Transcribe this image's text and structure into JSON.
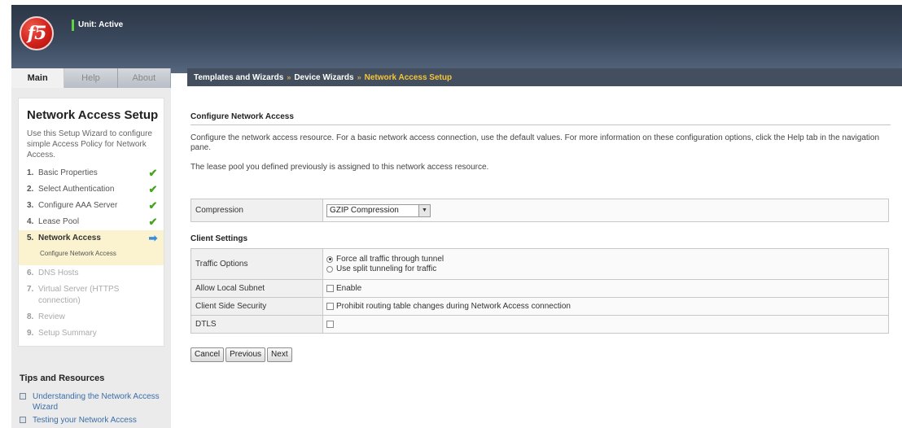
{
  "header": {
    "unit_status": "Unit: Active",
    "logo_text": "f5"
  },
  "tabs": [
    {
      "label": "Main",
      "active": true
    },
    {
      "label": "Help",
      "active": false
    },
    {
      "label": "About",
      "active": false
    }
  ],
  "breadcrumb": {
    "items": [
      "Templates and Wizards",
      "Device Wizards",
      "Network Access Setup"
    ],
    "separator": "»"
  },
  "sidebar": {
    "title": "Network Access Setup",
    "intro": "Use this Setup Wizard to configure simple Access Policy for Network Access.",
    "steps": [
      {
        "num": "1.",
        "label": "Basic Properties",
        "status": "✔"
      },
      {
        "num": "2.",
        "label": "Select Authentication",
        "status": "✔"
      },
      {
        "num": "3.",
        "label": "Configure AAA Server",
        "status": "✔"
      },
      {
        "num": "4.",
        "label": "Lease Pool",
        "status": "✔"
      },
      {
        "num": "5.",
        "label": "Network Access",
        "status": "➡"
      },
      {
        "num": "6.",
        "label": "DNS Hosts",
        "status": ""
      },
      {
        "num": "7.",
        "label": "Virtual Server (HTTPS connection)",
        "status": ""
      },
      {
        "num": "8.",
        "label": "Review",
        "status": ""
      },
      {
        "num": "9.",
        "label": "Setup Summary",
        "status": ""
      }
    ],
    "substep": "Configure Network Access",
    "tips_title": "Tips and Resources",
    "tips": [
      "Understanding the Network Access Wizard",
      "Testing your Network Access"
    ]
  },
  "main": {
    "section_title": "Configure Network Access",
    "description": "Configure the network access resource. For a basic network access connection, use the default values. For more information on these configuration options, click the Help tab in the navigation pane.",
    "lease_note": "The lease pool you defined previously is assigned to this network access resource.",
    "compression": {
      "label": "Compression",
      "value": "GZIP Compression"
    },
    "client_settings_title": "Client Settings",
    "traffic_options": {
      "label": "Traffic Options",
      "options": [
        "Force all traffic through tunnel",
        "Use split tunneling for traffic"
      ],
      "selected": "Force all traffic through tunnel"
    },
    "allow_local_subnet": {
      "label": "Allow Local Subnet",
      "option": "Enable",
      "checked": false
    },
    "client_side_security": {
      "label": "Client Side Security",
      "option": "Prohibit routing table changes during Network Access connection",
      "checked": false
    },
    "dtls": {
      "label": "DTLS",
      "checked": false
    },
    "buttons": {
      "cancel": "Cancel",
      "previous": "Previous",
      "next": "Next"
    }
  },
  "colors": {
    "accent_breadcrumb": "#f4c53a",
    "check": "#4aa31f",
    "current_step_bg": "#fbf3cf",
    "header_bg": "#3b4a5f"
  }
}
